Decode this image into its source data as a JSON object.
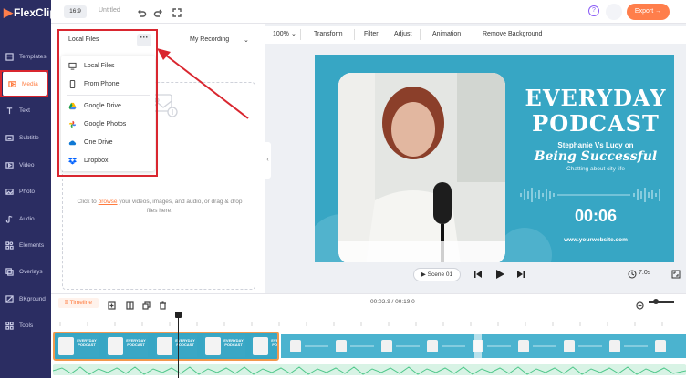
{
  "app": {
    "brand": "FlexClip",
    "aspect_ratio": "16:9",
    "project_title": "Untitled",
    "export_label": "Export →",
    "help_label": "?"
  },
  "sidebar": {
    "items": [
      {
        "label": "Templates",
        "icon": "templates-icon"
      },
      {
        "label": "Media",
        "icon": "media-icon",
        "active": true
      },
      {
        "label": "Text",
        "icon": "text-icon"
      },
      {
        "label": "Subtitle",
        "icon": "subtitle-icon"
      },
      {
        "label": "Video",
        "icon": "video-icon"
      },
      {
        "label": "Photo",
        "icon": "photo-icon"
      },
      {
        "label": "Audio",
        "icon": "audio-icon"
      },
      {
        "label": "Elements",
        "icon": "elements-icon"
      },
      {
        "label": "Overlays",
        "icon": "overlays-icon"
      },
      {
        "label": "BKground",
        "icon": "background-icon"
      },
      {
        "label": "Tools",
        "icon": "tools-icon"
      }
    ]
  },
  "media_panel": {
    "local_files": "Local Files",
    "more_label": "···",
    "my_recording": "My Recording",
    "drop_text_pre": "Click to ",
    "drop_text_link": "browse",
    "drop_text_post": " your videos, images, and audio, or drag & drop files here."
  },
  "source_menu": {
    "items": [
      {
        "label": "Local Files",
        "icon": "monitor-icon"
      },
      {
        "label": "From Phone",
        "icon": "phone-icon"
      },
      {
        "label": "Google Drive",
        "icon": "google-drive-icon"
      },
      {
        "label": "Google Photos",
        "icon": "google-photos-icon"
      },
      {
        "label": "One Drive",
        "icon": "onedrive-icon"
      },
      {
        "label": "Dropbox",
        "icon": "dropbox-icon"
      }
    ]
  },
  "edit_toolbar": {
    "zoom": "100%",
    "transform": "Transform",
    "filter": "Filter",
    "adjust": "Adjust",
    "animation": "Animation",
    "remove_background": "Remove Background"
  },
  "canvas": {
    "line1": "EVERYDAY",
    "line2": "PODCAST",
    "names": "Stephanie Vs Lucy on",
    "subtitle": "Being Successful",
    "tagline": "Chatting about city life",
    "timer": "00:06",
    "website": "www.yourwebsite.com",
    "background_color": "#37a6c4"
  },
  "playback": {
    "scene_label": "Scene 01",
    "duration": "7.0s"
  },
  "timeline": {
    "tab_label": "Timeline",
    "current_time": "00:03.9",
    "total_time": "00:19.0",
    "time_sep": " / ",
    "thumb_title": "EVERYDAY PODCAST"
  },
  "colors": {
    "accent": "#ff7e4b",
    "sidebar": "#2b2d62",
    "highlight_red": "#d9262f"
  }
}
